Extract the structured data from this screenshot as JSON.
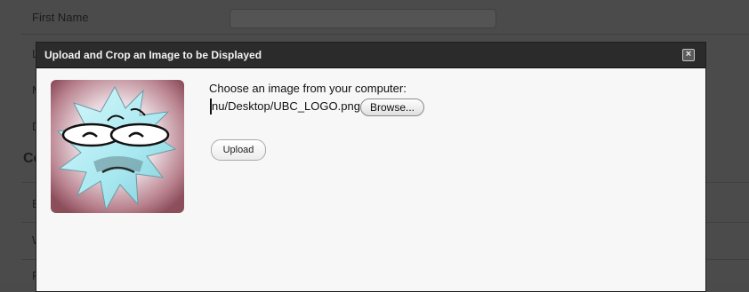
{
  "background": {
    "first_name_label": "First Name",
    "section_heading": "Co",
    "partial_labels": [
      "L",
      "M",
      "D",
      "E",
      "W",
      "P"
    ]
  },
  "dialog": {
    "title": "Upload and Crop an Image to be Displayed",
    "close_glyph": "×",
    "prompt": "Choose an image from your computer:",
    "file_path": "nu/Desktop/UBC_LOGO.png",
    "browse_label": "Browse...",
    "upload_label": "Upload"
  }
}
